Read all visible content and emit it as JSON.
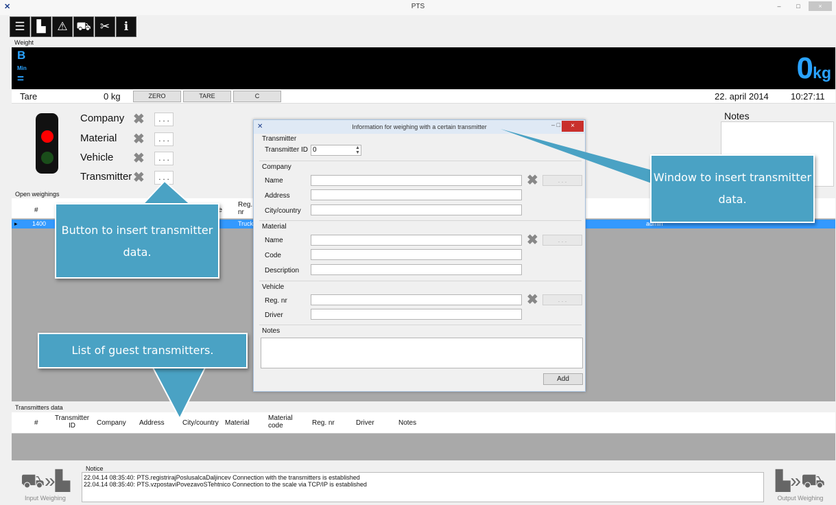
{
  "window": {
    "title": "PTS",
    "minimize": "–",
    "maximize": "□",
    "close": "×"
  },
  "toolbar": {
    "icons": [
      "list-icon",
      "factory-icon",
      "scale-icon",
      "truck-icon",
      "tools-icon",
      "info-icon"
    ],
    "glyphs": [
      "☰",
      "▙",
      "⚠",
      "⛟",
      "✂",
      "ℹ"
    ]
  },
  "weight": {
    "section_label": "Weight",
    "indicator_b": "B",
    "indicator_min": "Min",
    "indicator_eq": "=",
    "value": "0",
    "unit": "kg"
  },
  "tare": {
    "label": "Tare",
    "value": "0  kg",
    "zero_button": "ZERO",
    "tare_button": "TARE",
    "c_button": "C",
    "date": "22. april 2014",
    "time": "10:27:11"
  },
  "fields": {
    "company": "Company",
    "material": "Material",
    "vehicle": "Vehicle",
    "transmitter": "Transmitter",
    "dots": ". . ."
  },
  "notes_label": "Notes",
  "open_weighings": {
    "label": "Open weighings",
    "headers": {
      "num": "#",
      "de": "de",
      "reg": "Reg.\nnr"
    },
    "row": {
      "num": "1400",
      "reg": "Truck",
      "user": "admin"
    }
  },
  "transmitters_data": {
    "label": "Transmitters data",
    "headers": [
      "#",
      "Transmitter ID",
      "Company",
      "Address",
      "City/country",
      "Material",
      "Material code",
      "Reg. nr",
      "Driver",
      "Notes"
    ]
  },
  "notice": {
    "label": "Notice",
    "lines": [
      "22.04.14 08:35:40: PTS.registrirajPoslusalcaDaljincev Connection with the transmitters is established",
      "22.04.14 08:35:40: PTS.vzpostaviPovezavoSTehtnico Connection to the scale via TCP/IP is established"
    ]
  },
  "bottom": {
    "input_weighing": "Input Weighing",
    "output_weighing": "Output Weighing"
  },
  "dialog": {
    "title": "Information for weighing with a certain transmitter",
    "transmitter_section": "Transmitter",
    "transmitter_id_label": "Transmitter ID",
    "transmitter_id_value": "0",
    "company_section": "Company",
    "company_name": "Name",
    "company_address": "Address",
    "company_city": "City/country",
    "material_section": "Material",
    "material_name": "Name",
    "material_code": "Code",
    "material_description": "Description",
    "vehicle_section": "Vehicle",
    "vehicle_reg": "Reg. nr",
    "vehicle_driver": "Driver",
    "notes_section": "Notes",
    "add_button": "Add",
    "dots": ". . ."
  },
  "callouts": {
    "button": "Button to insert transmitter data.",
    "window": "Window to insert transmitter data.",
    "list": "List of guest transmitters."
  },
  "colors": {
    "display_bg": "#000000",
    "display_text": "#2aa3ff",
    "selected_row": "#3399ff",
    "callout": "#4aa2c4",
    "lamp_red": "#ff0000",
    "lamp_green": "#1a4d1a"
  }
}
